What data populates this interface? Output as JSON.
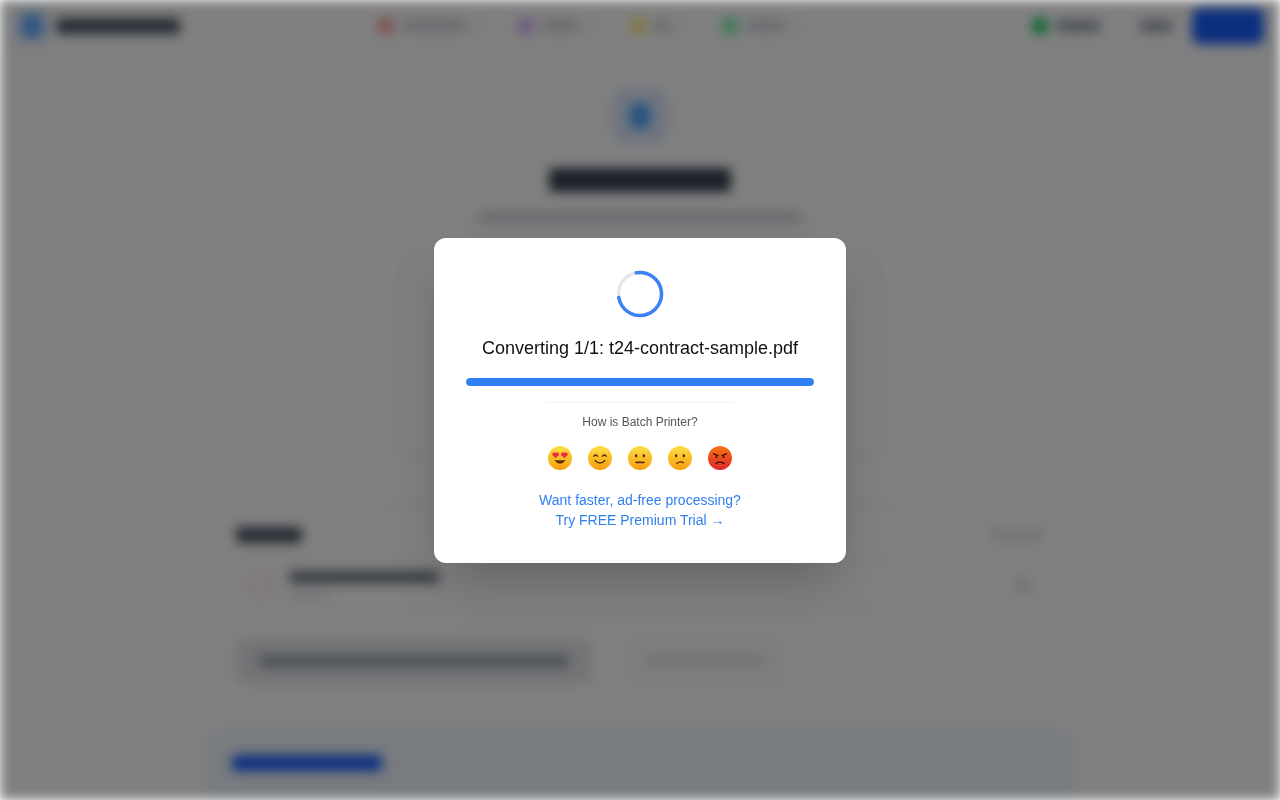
{
  "dialog": {
    "status": "Converting 1/1: t24-contract-sample.pdf",
    "progress": {
      "level": 1
    },
    "feedback": {
      "question": "How is Batch Printer?",
      "options": [
        {
          "kind": "love"
        },
        {
          "kind": "happy"
        },
        {
          "kind": "neutral"
        },
        {
          "kind": "confused"
        },
        {
          "kind": "angry"
        }
      ]
    },
    "promo": {
      "text": "Want faster, ad-free processing?",
      "link": "Try FREE Premium Trial →"
    }
  }
}
